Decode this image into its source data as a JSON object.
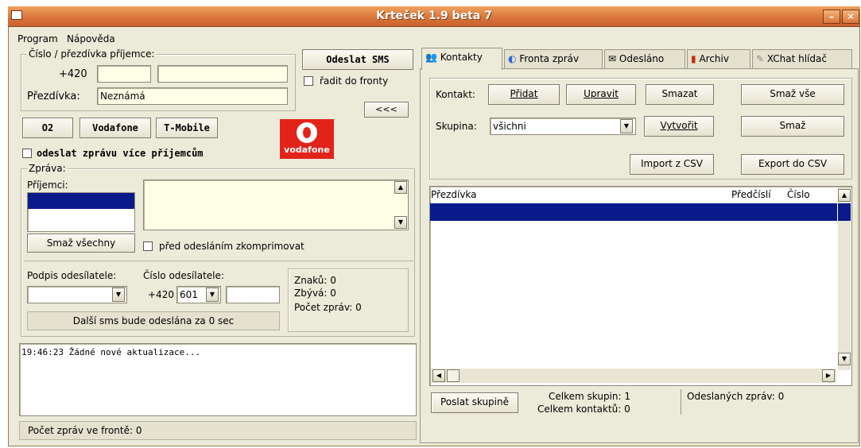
{
  "window": {
    "title": "Krteček 1.9 beta 7",
    "minimize": "–",
    "close": "✕"
  },
  "menu": [
    "Program",
    "Nápověda"
  ],
  "recipient": {
    "group_label": "Číslo / přezdívka příjemce:",
    "prefix": "+420",
    "number1": "",
    "number2": "",
    "nickname_label": "Přezdívka:",
    "nickname_value": "Neznámá"
  },
  "send": {
    "send_label": "Odeslat SMS",
    "queue_label": "řadit do fronty",
    "back_label": "<<<"
  },
  "operators": [
    "O2",
    "Vodafone",
    "T-Mobile"
  ],
  "logo_text": "vodafone",
  "multi_label": "odeslat zprávu více příjemcům",
  "message": {
    "group_label": "Zpráva:",
    "recipients_label": "Příjemci:",
    "delete_all_label": "Smaž všechny",
    "compress_label": "před odesláním zkomprimovat",
    "text": ""
  },
  "sender": {
    "signature_label": "Podpis odesílatele:",
    "number_label": "Číslo odesílatele:",
    "signature_value": "",
    "prefix": "+420",
    "operator_code": "601",
    "number_value": "",
    "countdown": "Další sms bude odeslána za 0 sec"
  },
  "stats": {
    "chars": "Znaků: 0",
    "remaining": "Zbývá: 0",
    "msg_count": "Počet zpráv: 0"
  },
  "log": {
    "line": "19:46:23  Žádné nové aktualizace..."
  },
  "status": {
    "queue": "Počet zpráv ve frontě: 0"
  },
  "tabs": [
    "Kontakty",
    "Fronta zpráv",
    "Odesláno",
    "Archiv",
    "XChat hlídač"
  ],
  "contacts": {
    "contact_label": "Kontakt:",
    "add": "Přidat",
    "edit": "Upravit",
    "delete": "Smazat",
    "delete_all": "Smaž vše",
    "group_label": "Skupina:",
    "group_value": "všichni",
    "create": "Vytvořit",
    "group_delete": "Smaž",
    "import": "Import z CSV",
    "export": "Export do CSV",
    "columns": [
      "Přezdívka",
      "Předčíslí",
      "Číslo"
    ]
  },
  "bottom": {
    "send_group": "Poslat skupině",
    "total_groups": "Celkem skupin: 1",
    "total_contacts": "Celkem kontaktů: 0",
    "sent_count": "Odeslaných zpráv: 0"
  },
  "colors": {
    "title": "#d9733a",
    "selection": "#0a1a8a",
    "field": "#ffffe8",
    "vodafone": "#e2231a"
  }
}
